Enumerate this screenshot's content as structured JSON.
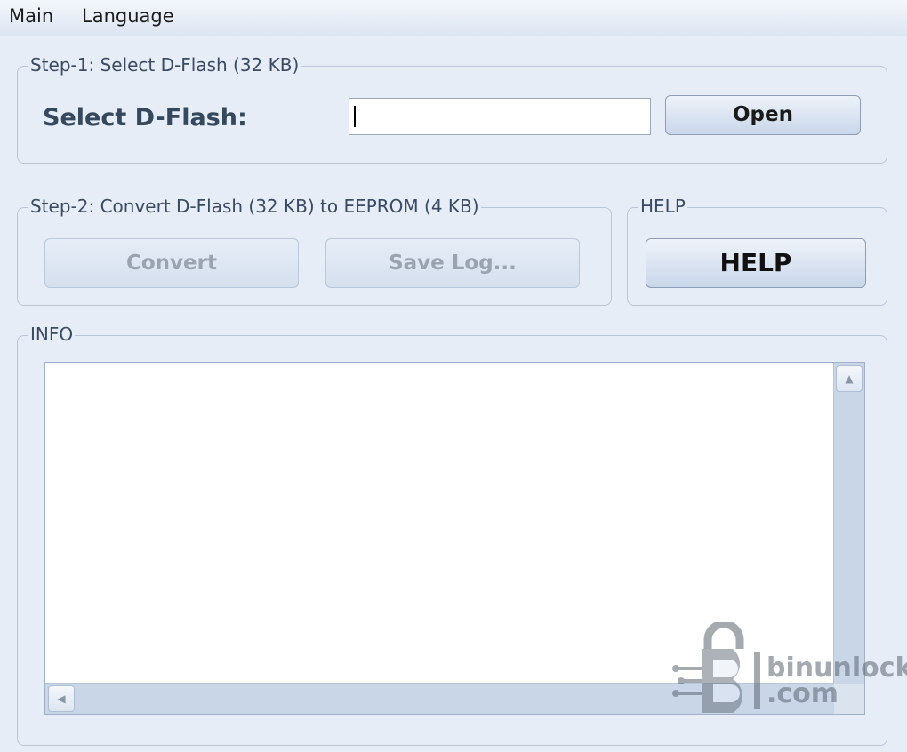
{
  "menu": {
    "main": "Main",
    "language": "Language"
  },
  "step1": {
    "legend": "Step-1: Select D-Flash (32 KB)",
    "select_label": "Select D-Flash:",
    "path_value": "",
    "open_button": "Open"
  },
  "step2": {
    "legend": "Step-2: Convert D-Flash (32 KB) to EEPROM (4 KB)",
    "convert_button": "Convert",
    "save_log_button": "Save Log..."
  },
  "help": {
    "legend": "HELP",
    "button": "HELP"
  },
  "info": {
    "legend": "INFO",
    "text": ""
  },
  "icons": {
    "scroll_up": "scroll-up-arrow-icon",
    "scroll_left": "scroll-left-arrow-icon",
    "watermark": "binunlock-logo"
  },
  "watermark": {
    "line1": "binunlock",
    "line2": ".com"
  },
  "colors": {
    "background": "#e7edf7",
    "label": "#34495e",
    "disabled_text": "#9aa4b1"
  }
}
